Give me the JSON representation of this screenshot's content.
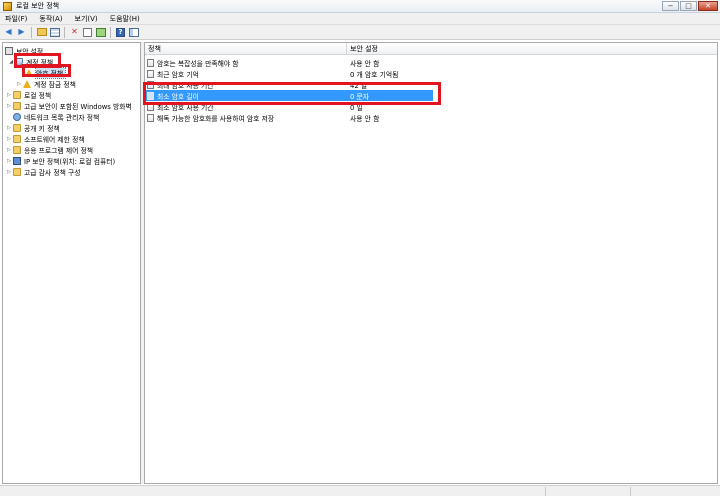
{
  "window": {
    "title": "로컬 보안 정책",
    "controls": {
      "minimize": "−",
      "maximize": "□",
      "close": "✕"
    }
  },
  "menu": [
    "파일(F)",
    "동작(A)",
    "보기(V)",
    "도움말(H)"
  ],
  "toolbar": {
    "icons": [
      "back-arrow-icon",
      "forward-arrow-icon",
      "up-folder-icon",
      "show-hide-tree-icon",
      "delete-icon",
      "properties-icon",
      "export-list-icon",
      "help-icon",
      "view-icon"
    ],
    "glyphs": {
      "back": "◀",
      "forward": "▶",
      "delete": "✕",
      "help": "?"
    }
  },
  "tree": {
    "root": "보안 설정",
    "items": [
      {
        "label": "계정 정책",
        "expander": "◢",
        "icon": "shield-icon"
      },
      {
        "label": "암호 정책",
        "expander": "",
        "icon": "folder-warning-icon"
      },
      {
        "label": "계정 잠금 정책",
        "expander": "▷",
        "icon": "folder-warning-icon"
      },
      {
        "label": "로컬 정책",
        "expander": "▷",
        "icon": "folder-icon"
      },
      {
        "label": "고급 보안이 포함된 Windows 방화벽",
        "expander": "▷",
        "icon": "folder-icon"
      },
      {
        "label": "네트워크 목록 관리자 정책",
        "expander": "",
        "icon": "network-icon"
      },
      {
        "label": "공개 키 정책",
        "expander": "▷",
        "icon": "folder-icon"
      },
      {
        "label": "소프트웨어 제한 정책",
        "expander": "▷",
        "icon": "folder-icon"
      },
      {
        "label": "응용 프로그램 제어 정책",
        "expander": "▷",
        "icon": "folder-icon"
      },
      {
        "label": "IP 보안 정책(위치: 로컬 컴퓨터)",
        "expander": "▷",
        "icon": "ip-security-icon"
      },
      {
        "label": "고급 감사 정책 구성",
        "expander": "▷",
        "icon": "folder-icon"
      }
    ]
  },
  "list": {
    "columns": [
      "정책",
      "보안 설정"
    ],
    "sort_indicator": "^",
    "rows": [
      {
        "policy": "암호는 복잡성을 만족해야 함",
        "setting": "사용 안 함"
      },
      {
        "policy": "최근 암호 기억",
        "setting": "0 개 암호 기억됨"
      },
      {
        "policy": "최대 암호 사용 기간",
        "setting": "42 일"
      },
      {
        "policy": "최소 암호 길이",
        "setting": "0 문자",
        "selected": true
      },
      {
        "policy": "최소 암호 사용 기간",
        "setting": "0 일"
      },
      {
        "policy": "해독 가능한 암호화를 사용하여 암호 저장",
        "setting": "사용 안 함"
      }
    ]
  },
  "colors": {
    "selection": "#3399ff",
    "annotation": "#e0151f"
  }
}
